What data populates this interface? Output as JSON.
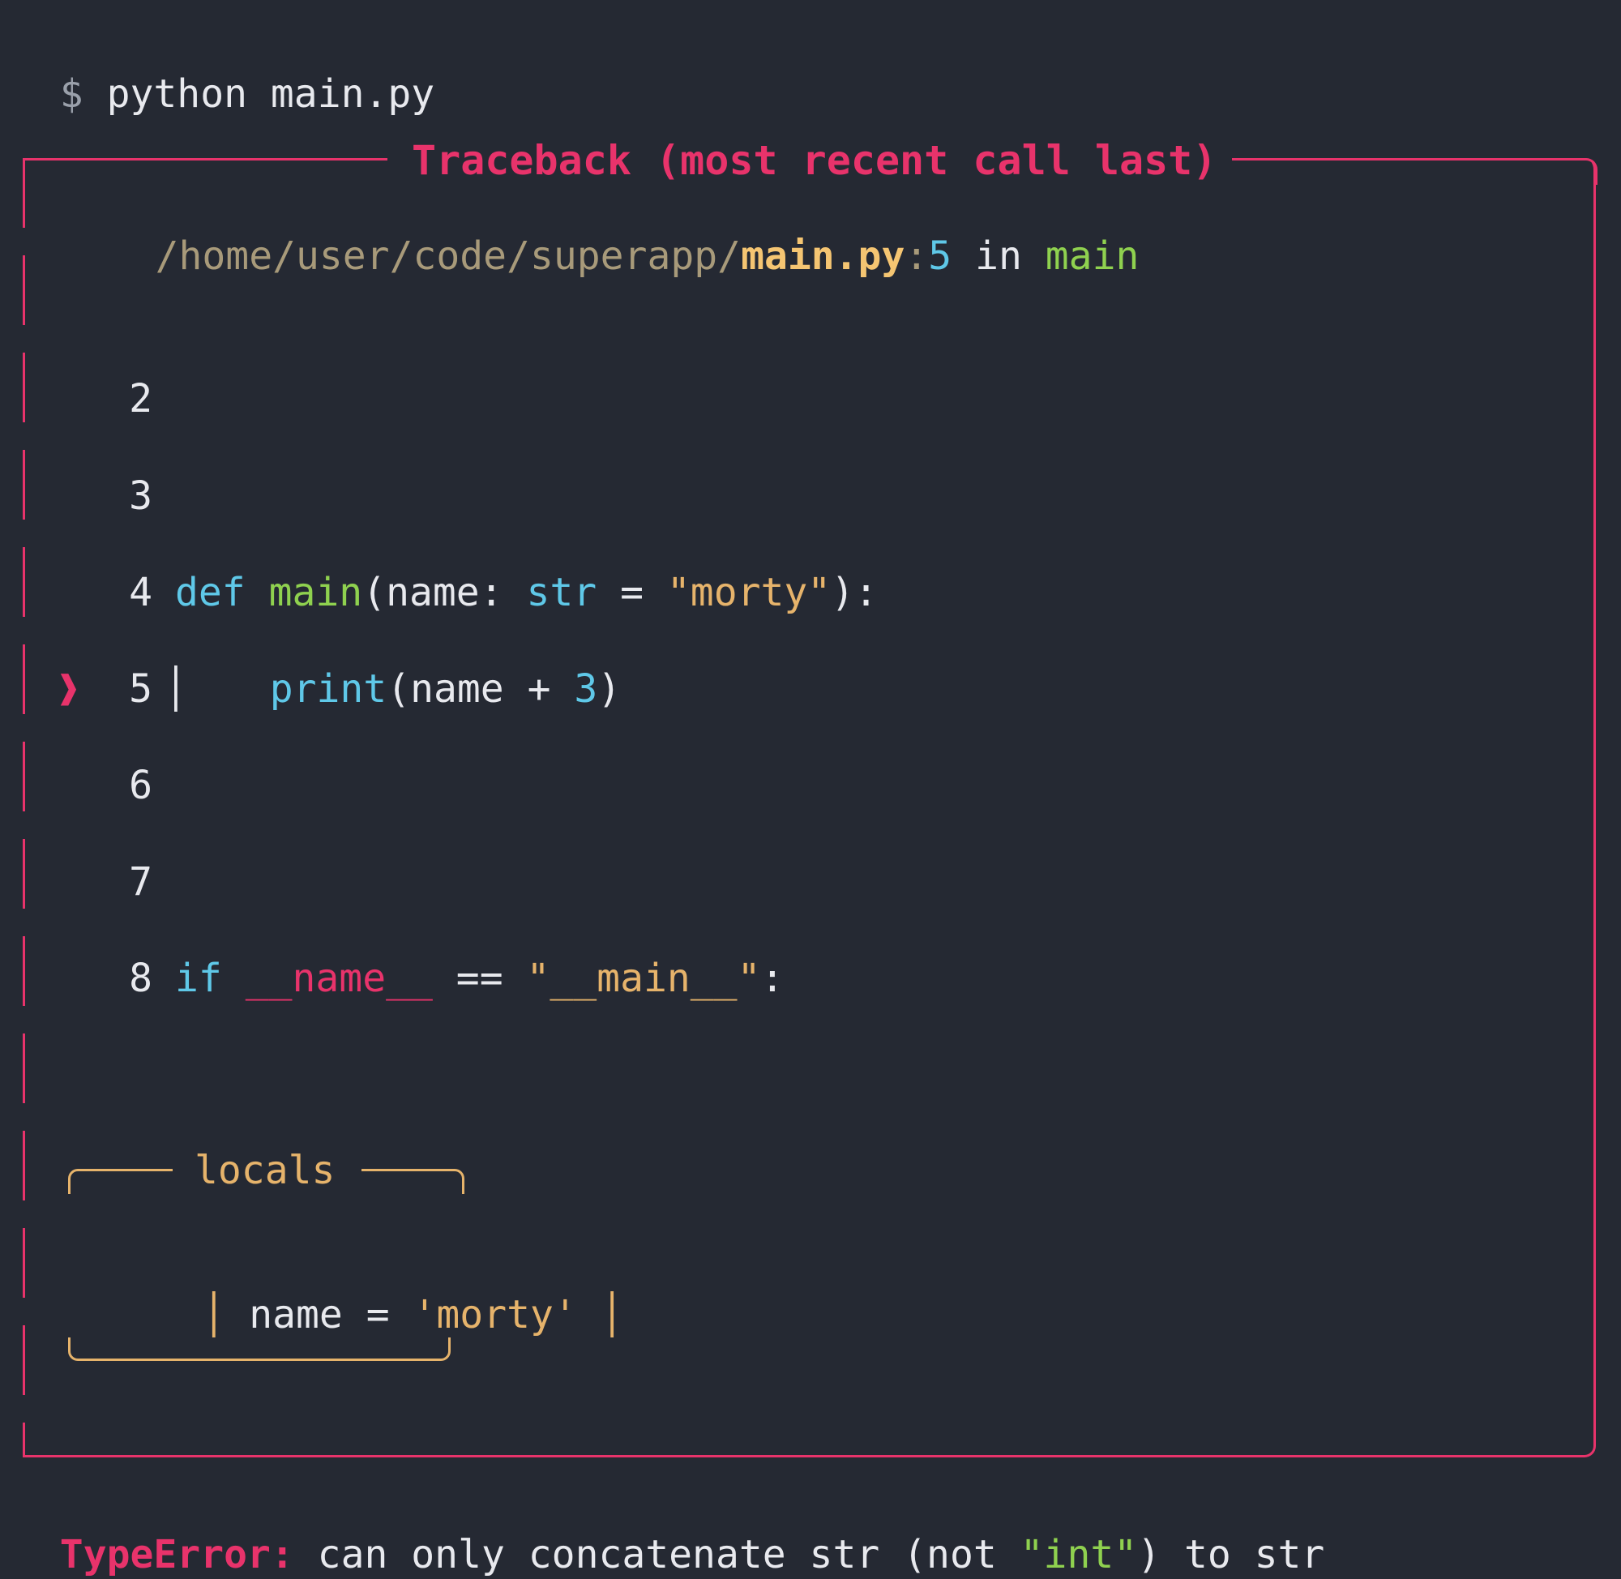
{
  "prompt": {
    "symbol": "$",
    "command": "python main.py"
  },
  "traceback": {
    "title": "Traceback (most recent call last)",
    "frame": {
      "path_dir": "/home/user/code/superapp/",
      "file": "main.py",
      "colon": ":",
      "lineno": "5",
      "in_word": " in ",
      "function": "main"
    },
    "code_lines": [
      {
        "num": "2",
        "marker": "",
        "sep": "",
        "tokens": []
      },
      {
        "num": "3",
        "marker": "",
        "sep": "",
        "tokens": []
      },
      {
        "num": "4",
        "marker": "",
        "sep": "",
        "tokens": [
          {
            "t": "def",
            "c": "cyan"
          },
          {
            "t": " ",
            "c": "white"
          },
          {
            "t": "main",
            "c": "green"
          },
          {
            "t": "(name: ",
            "c": "white"
          },
          {
            "t": "str",
            "c": "cyan"
          },
          {
            "t": " = ",
            "c": "white"
          },
          {
            "t": "\"morty\"",
            "c": "orange"
          },
          {
            "t": "):",
            "c": "white"
          }
        ]
      },
      {
        "num": "5",
        "marker": "❱",
        "sep": "│",
        "tokens": [
          {
            "t": "   ",
            "c": "white"
          },
          {
            "t": "print",
            "c": "cyan"
          },
          {
            "t": "(name + ",
            "c": "white"
          },
          {
            "t": "3",
            "c": "cyan"
          },
          {
            "t": ")",
            "c": "white"
          }
        ]
      },
      {
        "num": "6",
        "marker": "",
        "sep": "",
        "tokens": []
      },
      {
        "num": "7",
        "marker": "",
        "sep": "",
        "tokens": []
      },
      {
        "num": "8",
        "marker": "",
        "sep": "",
        "tokens": [
          {
            "t": "if",
            "c": "cyan"
          },
          {
            "t": " ",
            "c": "white"
          },
          {
            "t": "__name__",
            "c": "pink"
          },
          {
            "t": " == ",
            "c": "white"
          },
          {
            "t": "\"__main__\"",
            "c": "orange"
          },
          {
            "t": ":",
            "c": "white"
          }
        ]
      }
    ],
    "locals": {
      "title": "locals",
      "left_bar": "│",
      "right_bar": "│",
      "name": "name",
      "eq": " = ",
      "value": "'morty'"
    }
  },
  "error": {
    "type": "TypeError:",
    "message_pre": " can only concatenate str (not ",
    "message_quoted": "\"int\"",
    "message_post": ") to str"
  },
  "colors": {
    "background": "#252933",
    "accent_red": "#e8336b",
    "string_orange": "#e6b36b",
    "keyword_cyan": "#5fc8e8",
    "func_green": "#8fd14f"
  }
}
